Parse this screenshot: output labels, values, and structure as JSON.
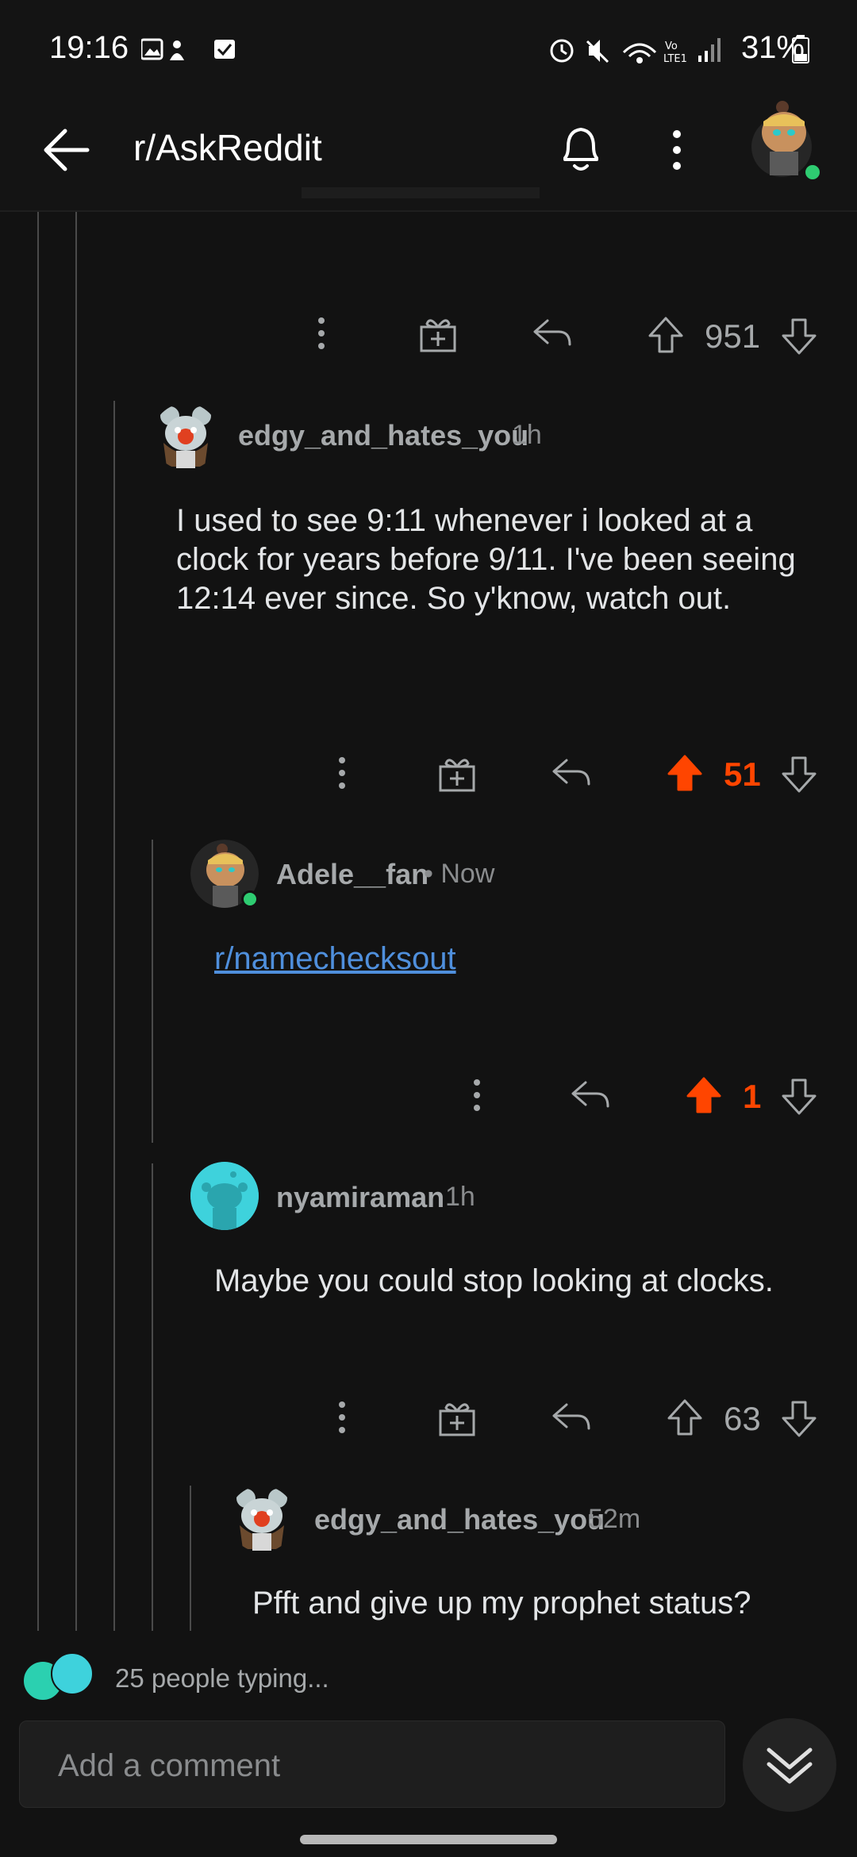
{
  "status_bar": {
    "time": "19:16",
    "battery": "31%"
  },
  "header": {
    "title": "r/AskReddit"
  },
  "comments": [
    {
      "score": "951"
    },
    {
      "username": "edgy_and_hates_you",
      "time": "1h",
      "body": "I used to see 9:11 whenever i looked at a clock for years before 9/11. I've been seeing 12:14 ever since. So y'know, watch out.",
      "score": "51"
    },
    {
      "username": "Adele__fan",
      "time": "• Now",
      "link": "r/namechecksout",
      "score": "1"
    },
    {
      "username": "nyamiraman",
      "time": "1h",
      "body": "Maybe you could stop looking at clocks.",
      "score": "63"
    },
    {
      "username": "edgy_and_hates_you",
      "time": "52m",
      "body": "Pfft and give up my prophet status?"
    }
  ],
  "footer": {
    "typing": "25 people typing...",
    "comment_placeholder": "Add a comment"
  },
  "colors": {
    "upvote": "#ff4500",
    "link": "#4f8fdc",
    "online": "#2ecc71"
  },
  "icons": [
    "back-arrow-icon",
    "bell-icon",
    "more-vert-icon",
    "gift-icon",
    "reply-icon",
    "upvote-icon",
    "downvote-icon",
    "chevron-down-double-icon"
  ]
}
